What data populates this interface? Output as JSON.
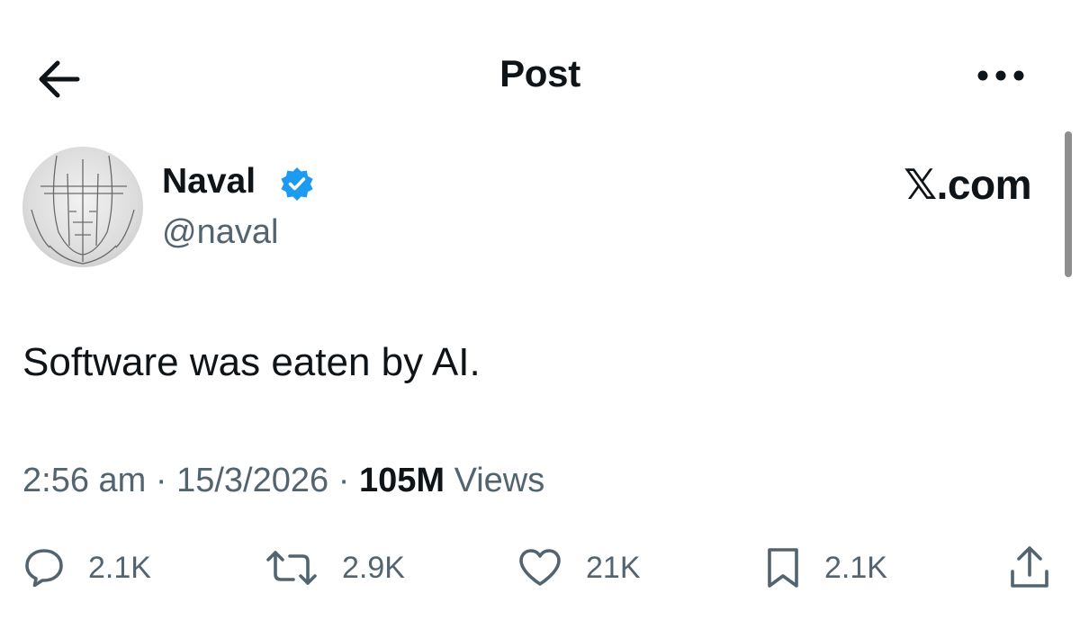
{
  "header": {
    "title": "Post",
    "back_icon": "arrow-left-icon",
    "more_icon": "more-dots-icon"
  },
  "author": {
    "display_name": "Naval",
    "handle": "@naval",
    "verified": true,
    "verified_color": "#1d9bf0"
  },
  "watermark": {
    "label": "𝕏.com"
  },
  "post": {
    "text": "Software was eaten by AI."
  },
  "meta": {
    "time": "2:56 am",
    "date": "15/3/2026",
    "views_count": "105M",
    "views_label": "Views",
    "separator": "·"
  },
  "actions": {
    "reply_count": "2.1K",
    "repost_count": "2.9K",
    "like_count": "21K",
    "bookmark_count": "2.1K"
  },
  "colors": {
    "text_primary": "#0f1419",
    "text_secondary": "#536471",
    "accent": "#1d9bf0"
  }
}
